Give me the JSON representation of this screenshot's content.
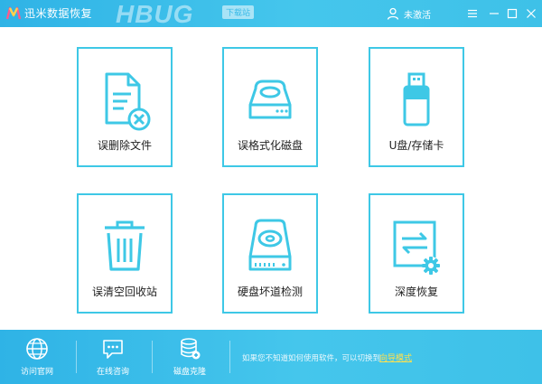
{
  "window": {
    "title": "迅米数据恢复",
    "watermark_text": "HBUG",
    "watermark_tag": "下载站",
    "user_label": "未激活",
    "icons": [
      "app-logo-icon",
      "user-icon",
      "menu-icon",
      "minimize-icon",
      "maximize-icon",
      "close-icon"
    ]
  },
  "cards": [
    {
      "label": "误删除文件",
      "icon": "deleted-file-icon"
    },
    {
      "label": "误格式化磁盘",
      "icon": "disk-drive-icon"
    },
    {
      "label": "U盘/存储卡",
      "icon": "usb-drive-icon"
    },
    {
      "label": "误清空回收站",
      "icon": "recycle-bin-icon"
    },
    {
      "label": "硬盘坏道检测",
      "icon": "hard-disk-icon"
    },
    {
      "label": "深度恢复",
      "icon": "deep-recovery-icon"
    }
  ],
  "footer": {
    "items": [
      {
        "label": "访问官网",
        "icon": "globe-icon"
      },
      {
        "label": "在线咨询",
        "icon": "chat-icon"
      },
      {
        "label": "磁盘克隆",
        "icon": "database-icon"
      }
    ],
    "hint": "如果您不知道如何使用软件，可以切换到",
    "link": "向导模式"
  },
  "colors": {
    "accent": "#3ec8e6",
    "bar": "#2fb3e6",
    "link": "#ffe14d"
  }
}
